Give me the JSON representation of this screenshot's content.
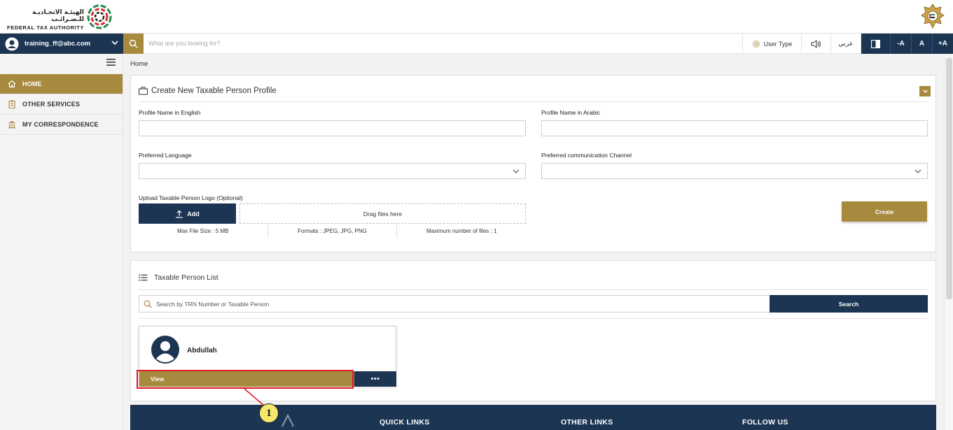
{
  "header": {
    "logo_arabic": "الهيئـة الاتحـاديـة للـضـرائـب",
    "logo_english": "FEDERAL TAX AUTHORITY",
    "brand_colors": {
      "navy": "#1c3553",
      "gold": "#a88a3f"
    }
  },
  "navbar": {
    "user_email": "training_ff@abc.com",
    "search_placeholder": "What are you looking for?",
    "user_type_label": "User Type",
    "arabic_label": "عربي",
    "font_decrease": "-A",
    "font_normal": "A",
    "font_increase": "+A"
  },
  "sidebar": {
    "items": [
      {
        "label": "HOME",
        "icon": "home-icon",
        "active": true
      },
      {
        "label": "OTHER SERVICES",
        "icon": "clipboard-icon",
        "active": false
      },
      {
        "label": "MY CORRESPONDENCE",
        "icon": "bank-icon",
        "active": false
      }
    ]
  },
  "breadcrumb": {
    "current": "Home"
  },
  "create_profile": {
    "title": "Create New Taxable Person Profile",
    "name_en_label": "Profile Name in English",
    "name_en_value": "",
    "name_ar_label": "Profile Name in Arabic",
    "name_ar_value": "",
    "language_label": "Preferred Language",
    "language_value": "",
    "channel_label": "Preferred communication Channel",
    "channel_value": "",
    "upload_label": "Upload Taxable Person Logo (Optional)",
    "add_label": "Add",
    "drop_text": "Drag files here",
    "max_size": "Max File Size : 5 MB",
    "formats": "Formats : JPEG, JPG, PNG",
    "max_files": "Maximum number of files : 1",
    "create_label": "Create"
  },
  "person_list": {
    "title": "Taxable Person List",
    "search_placeholder": "Search by TRN Number or Taxable Person",
    "search_label": "Search",
    "persons": [
      {
        "name": "Abdullah",
        "view_label": "View",
        "more_label": "•••"
      }
    ]
  },
  "annotation": {
    "step": "1"
  },
  "footer": {
    "quick_links": "QUICK LINKS",
    "other_links": "OTHER LINKS",
    "follow_us": "FOLLOW US"
  }
}
